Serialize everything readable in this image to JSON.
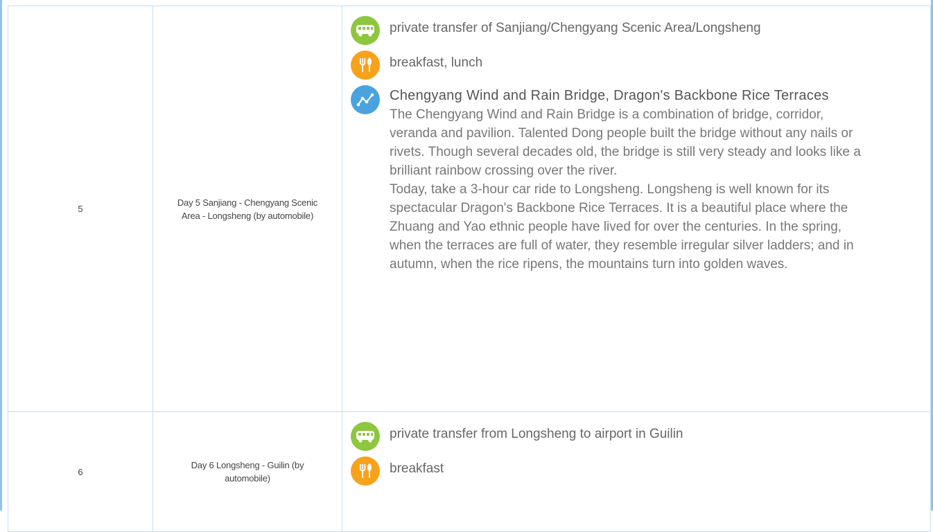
{
  "rows": [
    {
      "num": "5",
      "day": "Day 5 Sanjiang - Chengyang Scenic Area - Longsheng (by automobile)",
      "transfer": "private transfer of Sanjiang/Chengyang Scenic Area/Longsheng",
      "meals": "breakfast, lunch",
      "sight_title": "Chengyang Wind and Rain Bridge, Dragon's Backbone Rice Terraces",
      "sight_desc": "The Chengyang Wind and Rain Bridge is a combination of bridge, corridor, veranda and pavilion. Talented Dong people built the bridge without any nails or rivets. Though several decades old, the bridge is still very steady and looks like a brilliant rainbow crossing over the river.\nToday, take a 3-hour car ride to Longsheng. Longsheng is well known for its spectacular Dragon's Backbone Rice Terraces. It is a beautiful place where the Zhuang and Yao ethnic people have lived for over the centuries. In the spring, when the terraces are full of water, they resemble irregular silver ladders; and in autumn, when the rice ripens, the mountains turn into golden waves."
    },
    {
      "num": "6",
      "day": "Day 6 Longsheng - Guilin (by automobile)",
      "transfer": "private transfer from Longsheng to airport in Guilin",
      "meals": "breakfast"
    }
  ],
  "icons": {
    "transfer": "bus-icon",
    "meals": "fork-knife-icon",
    "sight": "route-icon"
  },
  "colors": {
    "transfer_icon": "#8dc63f",
    "meals_icon": "#f7a21b",
    "sight_icon": "#4aa3df",
    "frame_border": "#8ec4ea"
  }
}
